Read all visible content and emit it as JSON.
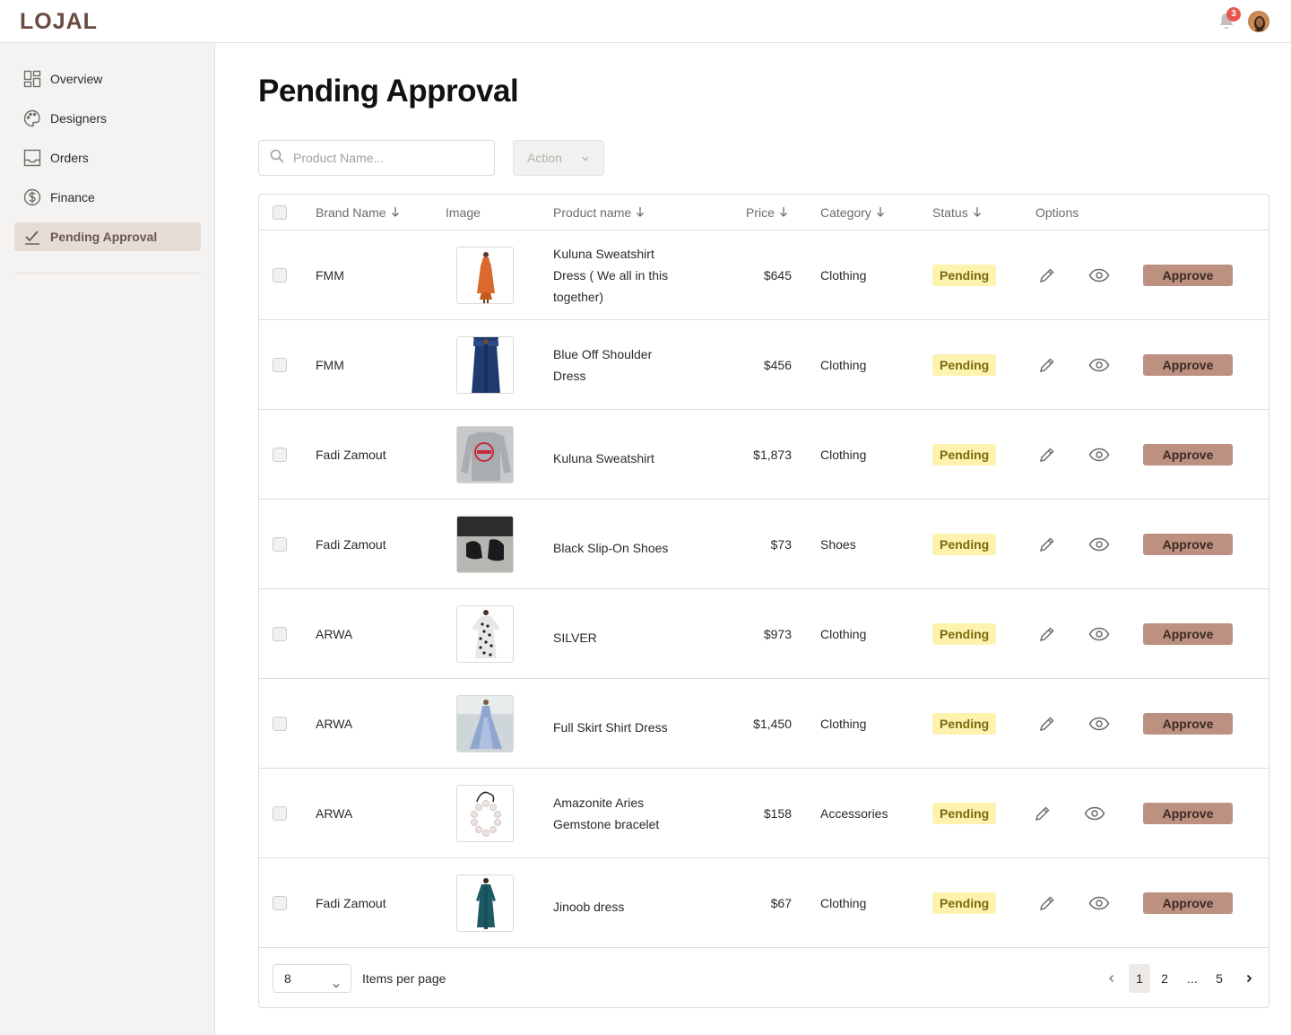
{
  "app": {
    "logo": "LOJAL"
  },
  "header": {
    "notification_count": "3"
  },
  "sidebar": {
    "items": [
      {
        "label": "Overview",
        "icon": "grid-icon"
      },
      {
        "label": "Designers",
        "icon": "palette-icon"
      },
      {
        "label": "Orders",
        "icon": "inbox-icon"
      },
      {
        "label": "Finance",
        "icon": "dollar-icon"
      },
      {
        "label": "Pending Approval",
        "icon": "check-icon",
        "active": true
      }
    ]
  },
  "page": {
    "title": "Pending Approval"
  },
  "toolbar": {
    "search_placeholder": "Product Name...",
    "action_label": "Action"
  },
  "table": {
    "columns": {
      "brand": "Brand Name",
      "image": "Image",
      "product": "Product name",
      "price": "Price",
      "category": "Category",
      "status": "Status",
      "options": "Options"
    },
    "approve_label": "Approve",
    "rows": [
      {
        "brand": "FMM",
        "product": "Kuluna Sweatshirt Dress ( We all in this together)",
        "price": "$645",
        "category": "Clothing",
        "status": "Pending",
        "image_desc": "orange-dress"
      },
      {
        "brand": "FMM",
        "product": "Blue Off Shoulder Dress",
        "price": "$456",
        "category": "Clothing",
        "status": "Pending",
        "image_desc": "blue-dress"
      },
      {
        "brand": "Fadi Zamout",
        "product": "Kuluna Sweatshirt",
        "price": "$1,873",
        "category": "Clothing",
        "status": "Pending",
        "image_desc": "grey-sweatshirt"
      },
      {
        "brand": "Fadi Zamout",
        "product": "Black Slip-On Shoes",
        "price": "$73",
        "category": "Shoes",
        "status": "Pending",
        "image_desc": "black-shoes"
      },
      {
        "brand": "ARWA",
        "product": "SILVER",
        "price": "$973",
        "category": "Clothing",
        "status": "Pending",
        "image_desc": "patterned-dress"
      },
      {
        "brand": "ARWA",
        "product": "Full Skirt Shirt Dress",
        "price": "$1,450",
        "category": "Clothing",
        "status": "Pending",
        "image_desc": "shirt-dress"
      },
      {
        "brand": "ARWA",
        "product": "Amazonite Aries Gemstone bracelet",
        "price": "$158",
        "category": "Accessories",
        "status": "Pending",
        "image_desc": "bracelet"
      },
      {
        "brand": "Fadi Zamout",
        "product": "Jinoob dress",
        "price": "$67",
        "category": "Clothing",
        "status": "Pending",
        "image_desc": "teal-dress"
      }
    ]
  },
  "pagination": {
    "per_page": "8",
    "per_page_label": "Items per page",
    "pages": [
      "1",
      "2",
      "...",
      "5"
    ],
    "current": "1"
  },
  "colors": {
    "accent": "#bc9181",
    "sidebar_active": "#e6dcd6",
    "pending_badge": "#fdf3ae",
    "notification": "#e8574c"
  }
}
